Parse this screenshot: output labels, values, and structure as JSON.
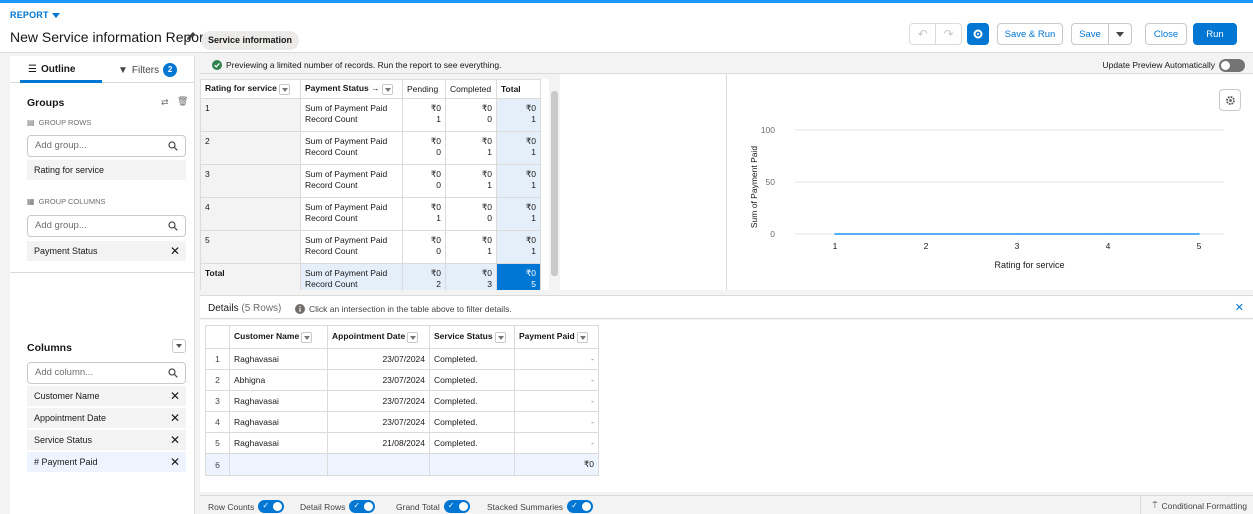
{
  "header": {
    "report_label": "REPORT",
    "title": "New Service information Report",
    "report_type": "Service information",
    "save_run_label": "Save & Run",
    "save_label": "Save",
    "close_label": "Close",
    "run_label": "Run"
  },
  "left_panel": {
    "tab_outline": "Outline",
    "tab_filters": "Filters",
    "filters_count": "2",
    "groups_title": "Groups",
    "group_rows_label": "GROUP ROWS",
    "add_group_placeholder": "Add group...",
    "group_rows": [
      "Rating for service"
    ],
    "group_columns_label": "GROUP COLUMNS",
    "group_columns": [
      "Payment Status"
    ],
    "columns_title": "Columns",
    "add_column_placeholder": "Add column...",
    "columns": [
      "Customer Name",
      "Appointment Date",
      "Service Status",
      "# Payment Paid"
    ]
  },
  "preview": {
    "message": "Previewing a limited number of records. Run the report to see everything.",
    "update_label": "Update Preview Automatically"
  },
  "matrix": {
    "row_group_header": "Rating for service",
    "col_group_header": "Payment Status →",
    "col_headers": [
      "Pending",
      "Completed",
      "Total"
    ],
    "measure_1": "Sum of Payment Paid",
    "measure_2": "Record Count",
    "rows": [
      {
        "label": "1",
        "pending": [
          "₹0",
          "1"
        ],
        "completed": [
          "₹0",
          "0"
        ],
        "total": [
          "₹0",
          "1"
        ]
      },
      {
        "label": "2",
        "pending": [
          "₹0",
          "0"
        ],
        "completed": [
          "₹0",
          "1"
        ],
        "total": [
          "₹0",
          "1"
        ]
      },
      {
        "label": "3",
        "pending": [
          "₹0",
          "0"
        ],
        "completed": [
          "₹0",
          "1"
        ],
        "total": [
          "₹0",
          "1"
        ]
      },
      {
        "label": "4",
        "pending": [
          "₹0",
          "1"
        ],
        "completed": [
          "₹0",
          "0"
        ],
        "total": [
          "₹0",
          "1"
        ]
      },
      {
        "label": "5",
        "pending": [
          "₹0",
          "0"
        ],
        "completed": [
          "₹0",
          "1"
        ],
        "total": [
          "₹0",
          "1"
        ]
      }
    ],
    "total_row": {
      "label": "Total",
      "pending": [
        "₹0",
        "2"
      ],
      "completed": [
        "₹0",
        "3"
      ],
      "total": [
        "₹0",
        "5"
      ]
    }
  },
  "chart_data": {
    "type": "line",
    "x": [
      1,
      2,
      3,
      4,
      5
    ],
    "categories": [
      "1",
      "2",
      "3",
      "4",
      "5"
    ],
    "values": [
      0,
      0,
      0,
      0,
      0
    ],
    "title": "",
    "xlabel": "Rating for service",
    "ylabel": "Sum of Payment Paid",
    "ylim": [
      0,
      100
    ],
    "yticks": [
      "0",
      "50",
      "100"
    ],
    "grid": true,
    "color": "#1b96ff"
  },
  "details": {
    "title": "Details",
    "count": "(5 Rows)",
    "hint": "Click an intersection in the table above to filter details.",
    "headers": [
      "Customer Name",
      "Appointment Date",
      "Service Status",
      "Payment Paid"
    ],
    "rows": [
      {
        "idx": "1",
        "name": "Raghavasai",
        "date": "23/07/2024",
        "status": "Completed.",
        "paid": "-"
      },
      {
        "idx": "2",
        "name": "Abhigna",
        "date": "23/07/2024",
        "status": "Completed.",
        "paid": "-"
      },
      {
        "idx": "3",
        "name": "Raghavasai",
        "date": "23/07/2024",
        "status": "Completed.",
        "paid": "-"
      },
      {
        "idx": "4",
        "name": "Raghavasai",
        "date": "23/07/2024",
        "status": "Completed.",
        "paid": "-"
      },
      {
        "idx": "5",
        "name": "Raghavasai",
        "date": "21/08/2024",
        "status": "Completed.",
        "paid": "-"
      }
    ],
    "summary": {
      "idx": "6",
      "paid": "₹0"
    }
  },
  "footer": {
    "row_counts": "Row Counts",
    "detail_rows": "Detail Rows",
    "grand_total": "Grand Total",
    "stacked_summaries": "Stacked Summaries",
    "conditional_formatting": "Conditional Formatting"
  },
  "colors": {
    "brand": "#0176d3",
    "success": "#2e844a"
  }
}
